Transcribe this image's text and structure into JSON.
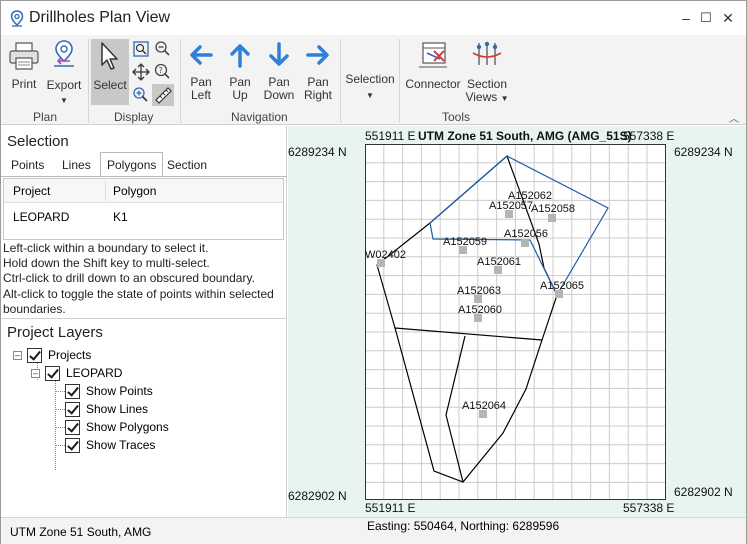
{
  "window": {
    "title": "Drillholes Plan View",
    "minimize": "–",
    "maximize": "☐",
    "close": "✕"
  },
  "ribbon": {
    "plan": {
      "group": "Plan",
      "print": "Print",
      "export": "Export"
    },
    "display": {
      "group": "Display",
      "select": "Select"
    },
    "navigation": {
      "group": "Navigation",
      "pan_left": [
        "Pan",
        "Left"
      ],
      "pan_up": [
        "Pan",
        "Up"
      ],
      "pan_down": [
        "Pan",
        "Down"
      ],
      "pan_right": [
        "Pan",
        "Right"
      ]
    },
    "selection": {
      "label": "Selection"
    },
    "tools": {
      "group": "Tools",
      "connector": "Connector",
      "section_views": [
        "Section",
        "Views"
      ]
    }
  },
  "selection_panel": {
    "title": "Selection",
    "tabs": [
      "Points",
      "Lines",
      "Polygons",
      "Section"
    ],
    "active_tab": "Polygons",
    "columns": [
      "Project",
      "Polygon"
    ],
    "rows": [
      [
        "LEOPARD",
        "K1"
      ]
    ],
    "hints": [
      "Left-click within a boundary to select it.",
      "Hold down the Shift key to multi-select.",
      "Ctrl-click to drill down to an obscured boundary.",
      "Alt-click to toggle the state of points within selected",
      "boundaries."
    ]
  },
  "layers": {
    "title": "Project Layers",
    "root": "Projects",
    "project": "LEOPARD",
    "items": [
      "Show Points",
      "Show Lines",
      "Show Polygons",
      "Show Traces"
    ]
  },
  "map": {
    "header": "UTM Zone 51 South, AMG (AMG_51S)",
    "x_min_label": "551911 E",
    "x_max_label": "557338 E",
    "y_max_label": "6289234 N",
    "y_min_label": "6282902 N",
    "points": [
      "A152062",
      "A152058",
      "A152057",
      "A152056",
      "A152059",
      "A152061",
      "W02402",
      "A152065",
      "A152063",
      "A152060",
      "A152064"
    ],
    "colors": {
      "blue_boundary": "#1f5fa8",
      "black_boundary": "#000000",
      "grid": "#cccccc",
      "point": "#b5b5b5",
      "background": "#e8f5ee"
    }
  },
  "status": {
    "left": "UTM Zone 51 South, AMG",
    "cursor": "Easting: 550464, Northing: 6289596"
  }
}
